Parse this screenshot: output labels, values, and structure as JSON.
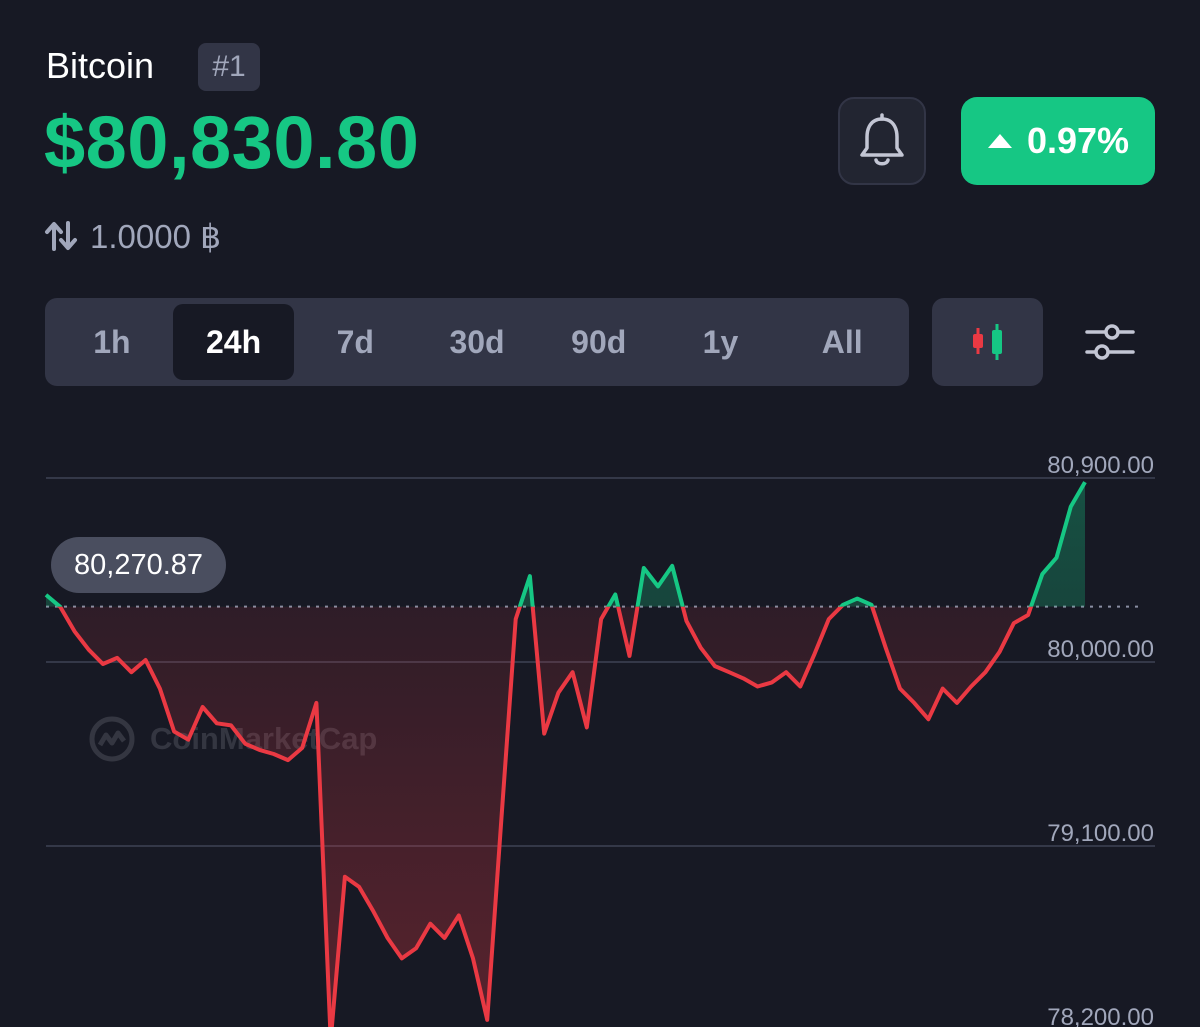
{
  "header": {
    "coin_name": "Bitcoin",
    "rank": "#1",
    "price": "$80,830.80",
    "change": "0.97%",
    "conversion": "1.0000 ฿"
  },
  "colors": {
    "background": "#171924",
    "up": "#16c784",
    "down": "#ea3943",
    "panel": "#323546",
    "muted": "#a1a7bb"
  },
  "icons": {
    "bell": "bell-icon",
    "change_arrow": "triangle-up-icon",
    "conversion": "swap-arrows-icon",
    "candles": "candlestick-icon",
    "settings": "sliders-icon"
  },
  "range_tabs": [
    {
      "label": "1h",
      "active": false
    },
    {
      "label": "24h",
      "active": true
    },
    {
      "label": "7d",
      "active": false
    },
    {
      "label": "30d",
      "active": false
    },
    {
      "label": "90d",
      "active": false
    },
    {
      "label": "1y",
      "active": false
    },
    {
      "label": "All",
      "active": false
    }
  ],
  "watermark": "CoinMarketCap",
  "chart_data": {
    "type": "line",
    "title": "",
    "xlabel": "",
    "ylabel": "",
    "series": [
      {
        "values": [
          80328,
          80270,
          80150,
          80060,
          79990,
          80020,
          79950,
          80010,
          79870,
          79660,
          79620,
          79780,
          79700,
          79690,
          79600,
          79570,
          79550,
          79520,
          79580,
          79800,
          78150,
          78950,
          78900,
          78780,
          78650,
          78550,
          78600,
          78720,
          78650,
          78760,
          78550,
          78250,
          79240,
          80210,
          80420,
          79650,
          79850,
          79950,
          79680,
          80210,
          80330,
          80030,
          80460,
          80370,
          80470,
          80200,
          80070,
          79980,
          79950,
          79920,
          79880,
          79900,
          79950,
          79880,
          80040,
          80210,
          80280,
          80310,
          80280,
          80070,
          79870,
          79800,
          79720,
          79870,
          79800,
          79880,
          79950,
          80050,
          80190,
          80230,
          80430,
          80510,
          80760,
          80880
        ]
      }
    ],
    "ylim": [
      78200,
      80900
    ],
    "y_ticks": [
      "80,900.00",
      "80,000.00",
      "79,100.00",
      "78,200.00"
    ],
    "reference_value": 80270.87,
    "reference_label": "80,270.87",
    "grid": true
  }
}
